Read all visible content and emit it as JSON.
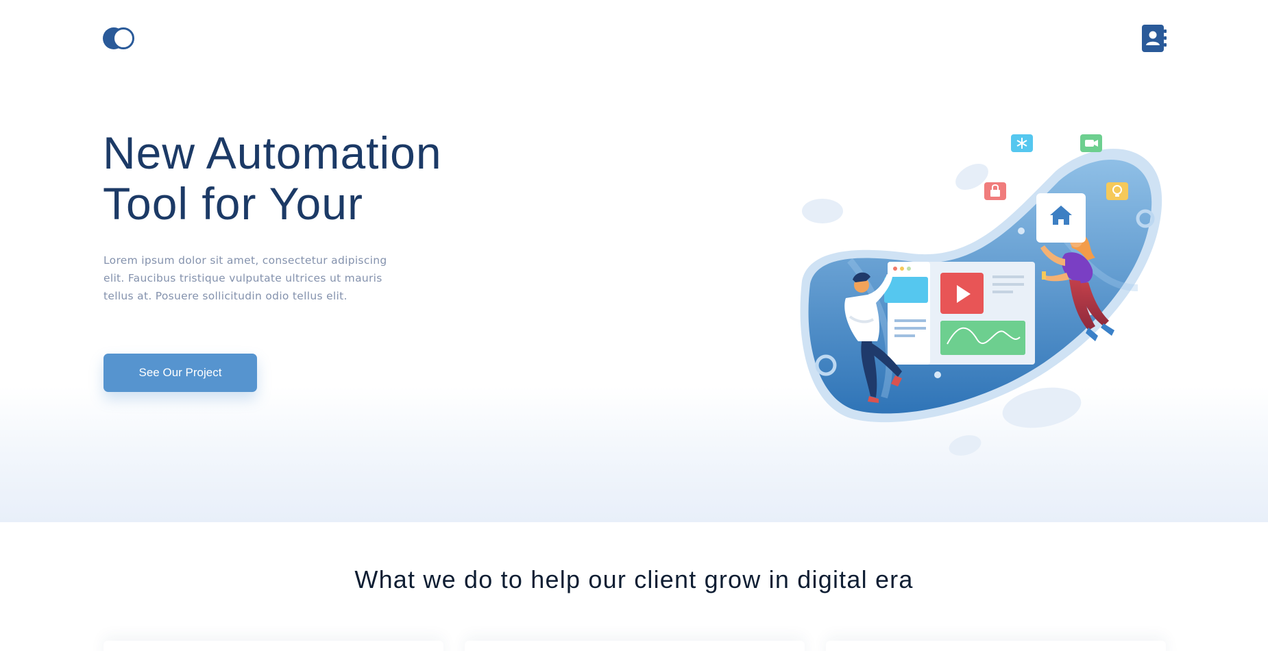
{
  "header": {
    "logo_icon": "toggle-circles-logo",
    "contact_icon": "contact-book-icon"
  },
  "hero": {
    "title_line1": "New Automation",
    "title_line2": "Tool for Your",
    "description": "Lorem ipsum dolor sit amet, consectetur adipiscing elit. Faucibus tristique vulputate ultrices ut mauris tellus at. Posuere sollicitudin odio tellus elit.",
    "cta_label": "See Our Project",
    "illustration": "automation-team-illustration"
  },
  "services": {
    "heading": "What we do to help our client grow in digital era"
  },
  "colors": {
    "primary": "#2a5a99",
    "accent": "#5694cf",
    "heading": "#1c3a66",
    "muted": "#8492ad"
  }
}
